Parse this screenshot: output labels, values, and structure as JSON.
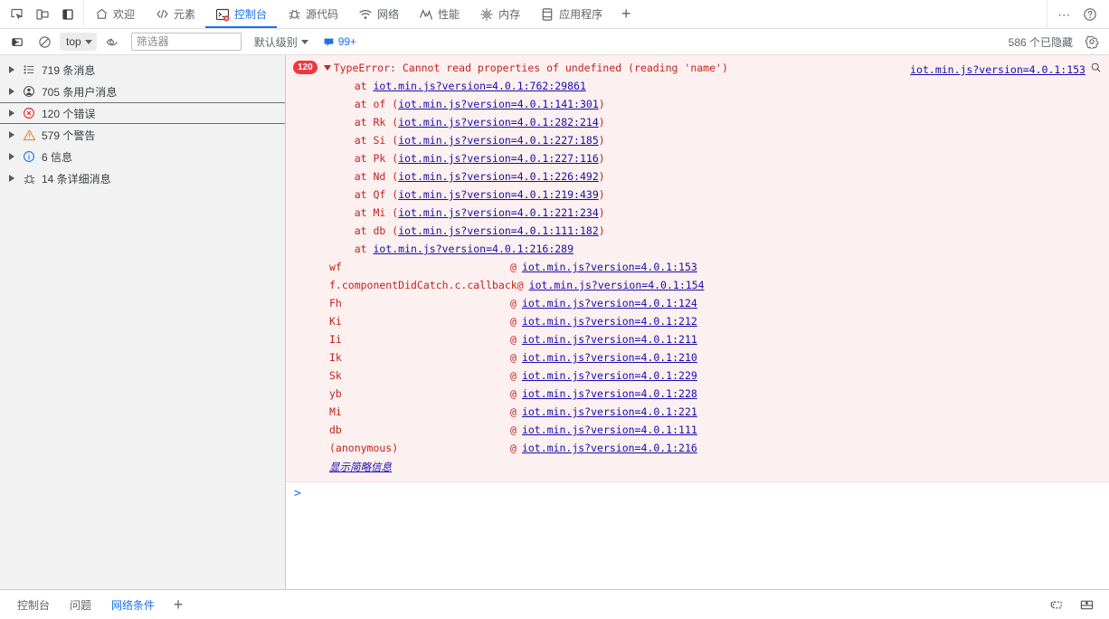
{
  "window": {
    "leftTools": [
      {
        "name": "inspect-element-icon",
        "title": "检查元素"
      },
      {
        "name": "device-toolbar-icon",
        "title": "切换设备工具栏"
      },
      {
        "name": "dock-side-icon",
        "title": "停靠位置"
      }
    ],
    "tabs": [
      {
        "id": "welcome",
        "label": "欢迎",
        "icon": "home-icon",
        "active": false
      },
      {
        "id": "elements",
        "label": "元素",
        "icon": "code-brackets-icon",
        "active": false
      },
      {
        "id": "console",
        "label": "控制台",
        "icon": "console-terminal-icon",
        "active": true,
        "errorBadge": true
      },
      {
        "id": "sources",
        "label": "源代码",
        "icon": "sources-bug-icon",
        "active": false
      },
      {
        "id": "network",
        "label": "网络",
        "icon": "wifi-icon",
        "active": false
      },
      {
        "id": "performance",
        "label": "性能",
        "icon": "performance-pulse-icon",
        "active": false
      },
      {
        "id": "memory",
        "label": "内存",
        "icon": "memory-chip-icon",
        "active": false
      },
      {
        "id": "application",
        "label": "应用程序",
        "icon": "application-panel-icon",
        "active": false
      }
    ],
    "addTabLabel": "+",
    "moreOptions": "more-options-icon",
    "help": "help-icon"
  },
  "toolbar": {
    "clear_console": "clear-console-icon",
    "no_entry": "no-entry-icon",
    "context": "top",
    "eye_icon": "live-expression-icon",
    "filter_placeholder": "筛选器",
    "filter_value": "",
    "level": "默认级别",
    "issues_count": "99+",
    "hidden_count": "586 个已隐藏",
    "settings_icon": "gear-icon"
  },
  "sidebar": {
    "items": [
      {
        "icon": "list-icon",
        "label": "719 条消息",
        "selected": false
      },
      {
        "icon": "user-icon",
        "label": "705 条用户消息",
        "selected": false
      },
      {
        "icon": "error-icon",
        "label": "120 个错误",
        "selected": true
      },
      {
        "icon": "warning-icon",
        "label": "579 个警告",
        "selected": false
      },
      {
        "icon": "info-icon",
        "label": "6 信息",
        "selected": false
      },
      {
        "icon": "verbose-bug-icon",
        "label": "14 条详细消息",
        "selected": false
      }
    ]
  },
  "console": {
    "message": {
      "count": "120",
      "title": "TypeError: Cannot read properties of undefined (reading 'name')",
      "source_link": "iot.min.js?version=4.0.1:153",
      "search_icon": "magnifier-icon",
      "stack_lines": [
        {
          "prefix": "    at ",
          "fn": "",
          "open": "",
          "link": "iot.min.js?version=4.0.1:762:29861",
          "close": ""
        },
        {
          "prefix": "    at ",
          "fn": "of",
          "open": " (",
          "link": "iot.min.js?version=4.0.1:141:301",
          "close": ")"
        },
        {
          "prefix": "    at ",
          "fn": "Rk",
          "open": " (",
          "link": "iot.min.js?version=4.0.1:282:214",
          "close": ")"
        },
        {
          "prefix": "    at ",
          "fn": "Si",
          "open": " (",
          "link": "iot.min.js?version=4.0.1:227:185",
          "close": ")"
        },
        {
          "prefix": "    at ",
          "fn": "Pk",
          "open": " (",
          "link": "iot.min.js?version=4.0.1:227:116",
          "close": ")"
        },
        {
          "prefix": "    at ",
          "fn": "Nd",
          "open": " (",
          "link": "iot.min.js?version=4.0.1:226:492",
          "close": ")"
        },
        {
          "prefix": "    at ",
          "fn": "Qf",
          "open": " (",
          "link": "iot.min.js?version=4.0.1:219:439",
          "close": ")"
        },
        {
          "prefix": "    at ",
          "fn": "Mi",
          "open": " (",
          "link": "iot.min.js?version=4.0.1:221:234",
          "close": ")"
        },
        {
          "prefix": "    at ",
          "fn": "db",
          "open": " (",
          "link": "iot.min.js?version=4.0.1:111:182",
          "close": ")"
        },
        {
          "prefix": "    at ",
          "fn": "",
          "open": "",
          "link": "iot.min.js?version=4.0.1:216:289",
          "close": ""
        }
      ],
      "frames": [
        {
          "fn": "wf",
          "at": "@",
          "link": "iot.min.js?version=4.0.1:153"
        },
        {
          "fn": "f.componentDidCatch.c.callback",
          "at": "@",
          "link": "iot.min.js?version=4.0.1:154"
        },
        {
          "fn": "Fh",
          "at": "@",
          "link": "iot.min.js?version=4.0.1:124"
        },
        {
          "fn": "Ki",
          "at": "@",
          "link": "iot.min.js?version=4.0.1:212"
        },
        {
          "fn": "Ii",
          "at": "@",
          "link": "iot.min.js?version=4.0.1:211"
        },
        {
          "fn": "Ik",
          "at": "@",
          "link": "iot.min.js?version=4.0.1:210"
        },
        {
          "fn": "Sk",
          "at": "@",
          "link": "iot.min.js?version=4.0.1:229"
        },
        {
          "fn": "yb",
          "at": "@",
          "link": "iot.min.js?version=4.0.1:228"
        },
        {
          "fn": "Mi",
          "at": "@",
          "link": "iot.min.js?version=4.0.1:221"
        },
        {
          "fn": "db",
          "at": "@",
          "link": "iot.min.js?version=4.0.1:111"
        },
        {
          "fn": "(anonymous)",
          "at": "@",
          "link": "iot.min.js?version=4.0.1:216"
        }
      ],
      "show_less": "显示简略信息"
    },
    "prompt_symbol": ">"
  },
  "drawer": {
    "tabs": [
      {
        "id": "console",
        "label": "控制台",
        "active": false
      },
      {
        "id": "issues",
        "label": "问题",
        "active": false
      },
      {
        "id": "network-conditions",
        "label": "网络条件",
        "active": true
      }
    ],
    "addLabel": "+",
    "rightIcons": [
      {
        "name": "devices-icon"
      },
      {
        "name": "drawer-dock-icon"
      }
    ]
  },
  "colors": {
    "accent": "#1a73e8",
    "error": "#c5221f",
    "error_bg": "#fdf0f0",
    "badge": "#eb3941",
    "link": "#1a0dab",
    "warning": "#f29900",
    "sidebar_bg": "#f2f2f2"
  }
}
